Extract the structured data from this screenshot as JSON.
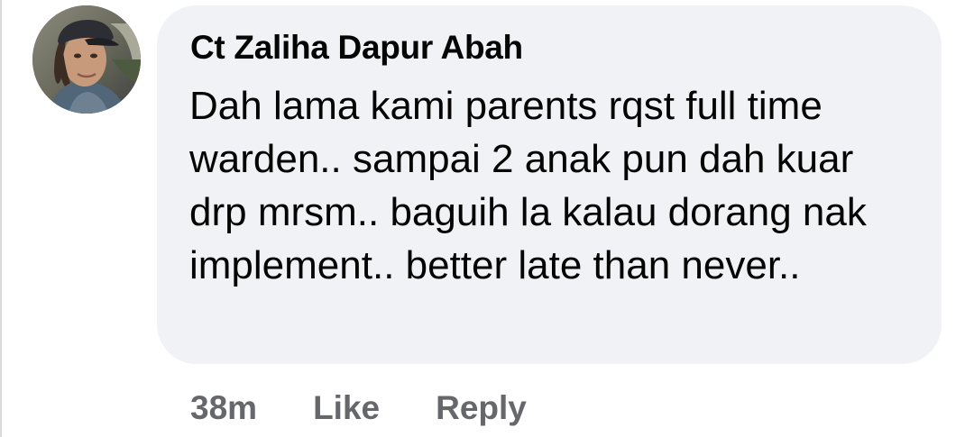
{
  "comment": {
    "author": "Ct Zaliha Dapur Abah",
    "text": "Dah lama kami parents rqst full time warden.. sampai 2 anak pun dah kuar drp mrsm.. baguih la kalau dorang nak implement.. better late than never..",
    "time": "38m",
    "like_label": "Like",
    "reply_label": "Reply"
  },
  "colors": {
    "bubble_background": "#f0f2f5",
    "primary_text": "#050505",
    "secondary_text": "#65676b"
  },
  "icons": {
    "avatar": "profile-photo"
  }
}
